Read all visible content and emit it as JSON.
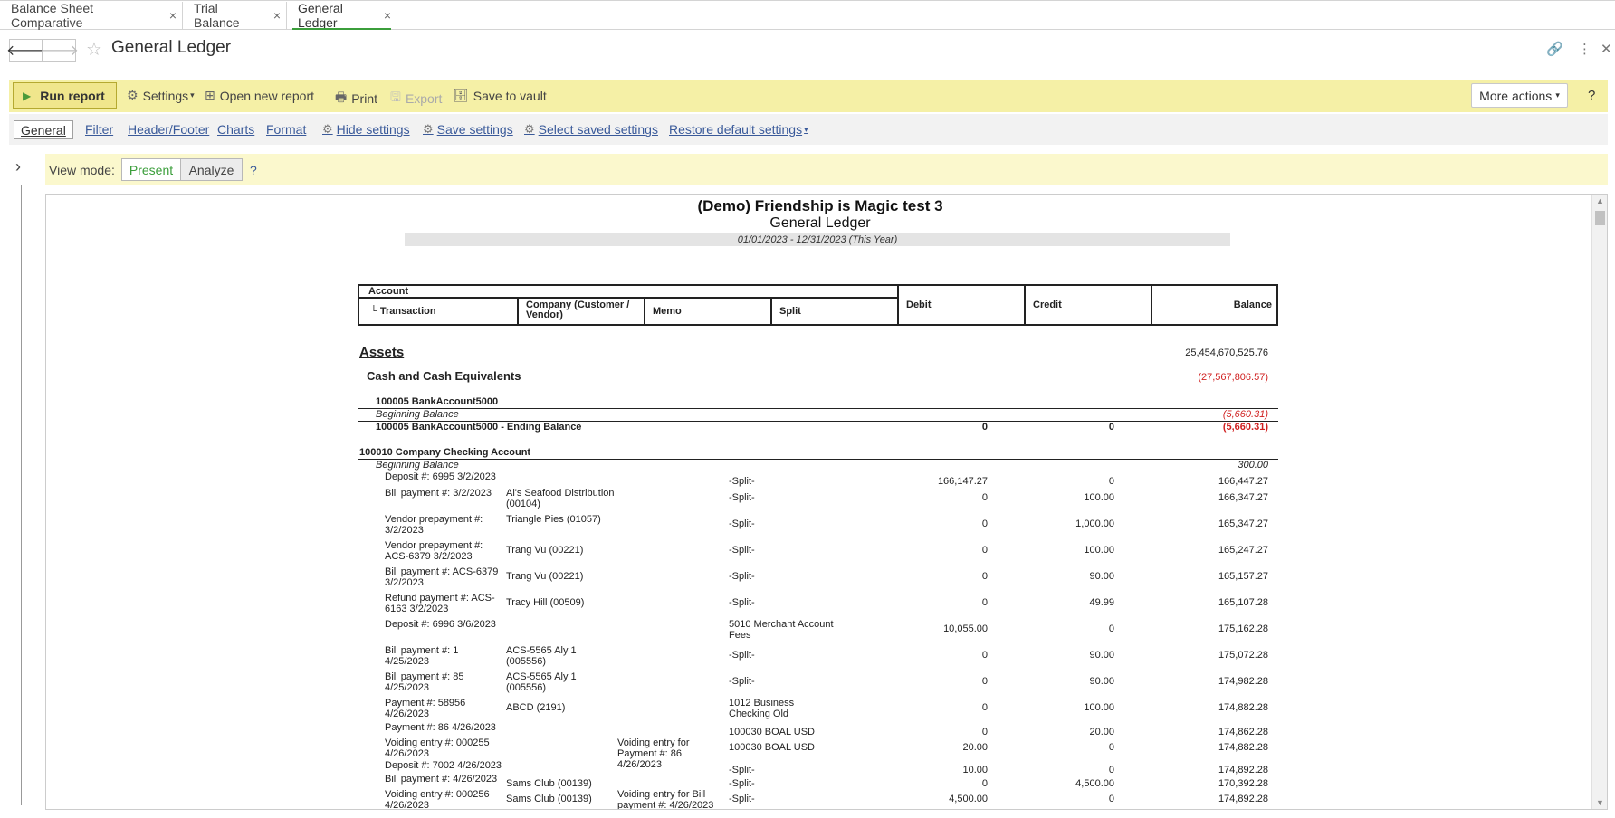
{
  "tabs": [
    {
      "label": "Balance Sheet Comparative",
      "active": false
    },
    {
      "label": "Trial Balance",
      "active": false
    },
    {
      "label": "General Ledger",
      "active": true
    }
  ],
  "header": {
    "title": "General Ledger"
  },
  "toolbar": {
    "run_report": "Run report",
    "settings": "Settings",
    "open_new_report": "Open new report",
    "print": "Print",
    "export": "Export",
    "save_to_vault": "Save to vault",
    "more_actions": "More actions",
    "help": "?"
  },
  "settings_tabs": {
    "general": "General",
    "filter": "Filter",
    "header_footer": "Header/Footer",
    "charts": "Charts",
    "format": "Format",
    "hide_settings": "Hide settings",
    "save_settings": "Save settings",
    "select_saved_settings": "Select saved settings",
    "restore_default_settings": "Restore default settings"
  },
  "view_mode": {
    "label": "View mode:",
    "present": "Present",
    "analyze": "Analyze",
    "help": "?"
  },
  "report": {
    "company": "(Demo) Friendship is Magic test 3",
    "title": "General Ledger",
    "period": "01/01/2023 - 12/31/2023 (This Year)",
    "columns": {
      "account": "Account",
      "transaction": "└ Transaction",
      "company": "Company (Customer / Vendor)",
      "memo": "Memo",
      "split": "Split",
      "debit": "Debit",
      "credit": "Credit",
      "balance": "Balance"
    },
    "assets": {
      "label": "Assets",
      "balance": "25,454,670,525.76"
    },
    "cash": {
      "label": "Cash and Cash Equivalents",
      "balance": "(27,567,806.57)"
    },
    "acct1": {
      "name": "100005 BankAccount5000",
      "beginning_label": "Beginning Balance",
      "beginning_balance": "(5,660.31)",
      "ending_label": "100005 BankAccount5000 - Ending Balance",
      "ending_debit": "0",
      "ending_credit": "0",
      "ending_balance": "(5,660.31)"
    },
    "acct2": {
      "name": "100010 Company Checking Account",
      "beginning_label": "Beginning Balance",
      "beginning_balance": "300.00"
    },
    "rows": [
      {
        "transaction": "Deposit #: 6995 3/2/2023",
        "company": "",
        "memo": "",
        "split": "-Split-",
        "debit": "166,147.27",
        "credit": "0",
        "balance": "166,447.27"
      },
      {
        "transaction": "Bill payment #: 3/2/2023",
        "company": "Al's Seafood Distribution (00104)",
        "memo": "",
        "split": "-Split-",
        "debit": "0",
        "credit": "100.00",
        "balance": "166,347.27"
      },
      {
        "transaction": "Vendor prepayment #: 3/2/2023",
        "company": "Triangle Pies (01057)",
        "memo": "",
        "split": "-Split-",
        "debit": "0",
        "credit": "1,000.00",
        "balance": "165,347.27"
      },
      {
        "transaction": "Vendor prepayment #: ACS-6379 3/2/2023",
        "company": "Trang Vu (00221)",
        "memo": "",
        "split": "-Split-",
        "debit": "0",
        "credit": "100.00",
        "balance": "165,247.27"
      },
      {
        "transaction": "Bill payment #: ACS-6379 3/2/2023",
        "company": "Trang Vu (00221)",
        "memo": "",
        "split": "-Split-",
        "debit": "0",
        "credit": "90.00",
        "balance": "165,157.27"
      },
      {
        "transaction": "Refund payment #: ACS-6163 3/2/2023",
        "company": "Tracy Hill (00509)",
        "memo": "",
        "split": "-Split-",
        "debit": "0",
        "credit": "49.99",
        "balance": "165,107.28"
      },
      {
        "transaction": "Deposit #: 6996 3/6/2023",
        "company": "",
        "memo": "",
        "split": "5010 Merchant Account Fees",
        "debit": "10,055.00",
        "credit": "0",
        "balance": "175,162.28"
      },
      {
        "transaction": "Bill payment #: 1 4/25/2023",
        "company": "ACS-5565 Aly 1 (005556)",
        "memo": "",
        "split": "-Split-",
        "debit": "0",
        "credit": "90.00",
        "balance": "175,072.28"
      },
      {
        "transaction": "Bill payment #: 85 4/25/2023",
        "company": "ACS-5565 Aly 1 (005556)",
        "memo": "",
        "split": "-Split-",
        "debit": "0",
        "credit": "90.00",
        "balance": "174,982.28"
      },
      {
        "transaction": "Payment #: 58956 4/26/2023",
        "company": "ABCD (2191)",
        "memo": "",
        "split": "1012 Business Checking Old",
        "debit": "0",
        "credit": "100.00",
        "balance": "174,882.28"
      },
      {
        "transaction": "Payment #: 86 4/26/2023",
        "company": "",
        "memo": "",
        "split": "100030 BOAL USD",
        "debit": "0",
        "credit": "20.00",
        "balance": "174,862.28"
      },
      {
        "transaction": "Voiding entry #: 000255 4/26/2023",
        "company": "",
        "memo": "Voiding entry for Payment #: 86 4/26/2023",
        "split": "100030 BOAL USD",
        "debit": "20.00",
        "credit": "0",
        "balance": "174,882.28"
      },
      {
        "transaction": "Deposit #: 7002 4/26/2023",
        "company": "",
        "memo": "",
        "split": "-Split-",
        "debit": "10.00",
        "credit": "0",
        "balance": "174,892.28"
      },
      {
        "transaction": "Bill payment #: 4/26/2023",
        "company": "Sams Club (00139)",
        "memo": "",
        "split": "-Split-",
        "debit": "0",
        "credit": "4,500.00",
        "balance": "170,392.28"
      },
      {
        "transaction": "Voiding entry #: 000256 4/26/2023",
        "company": "Sams Club (00139)",
        "memo": "Voiding entry for Bill payment #: 4/26/2023",
        "split": "-Split-",
        "debit": "4,500.00",
        "credit": "0",
        "balance": "174,892.28"
      }
    ]
  }
}
